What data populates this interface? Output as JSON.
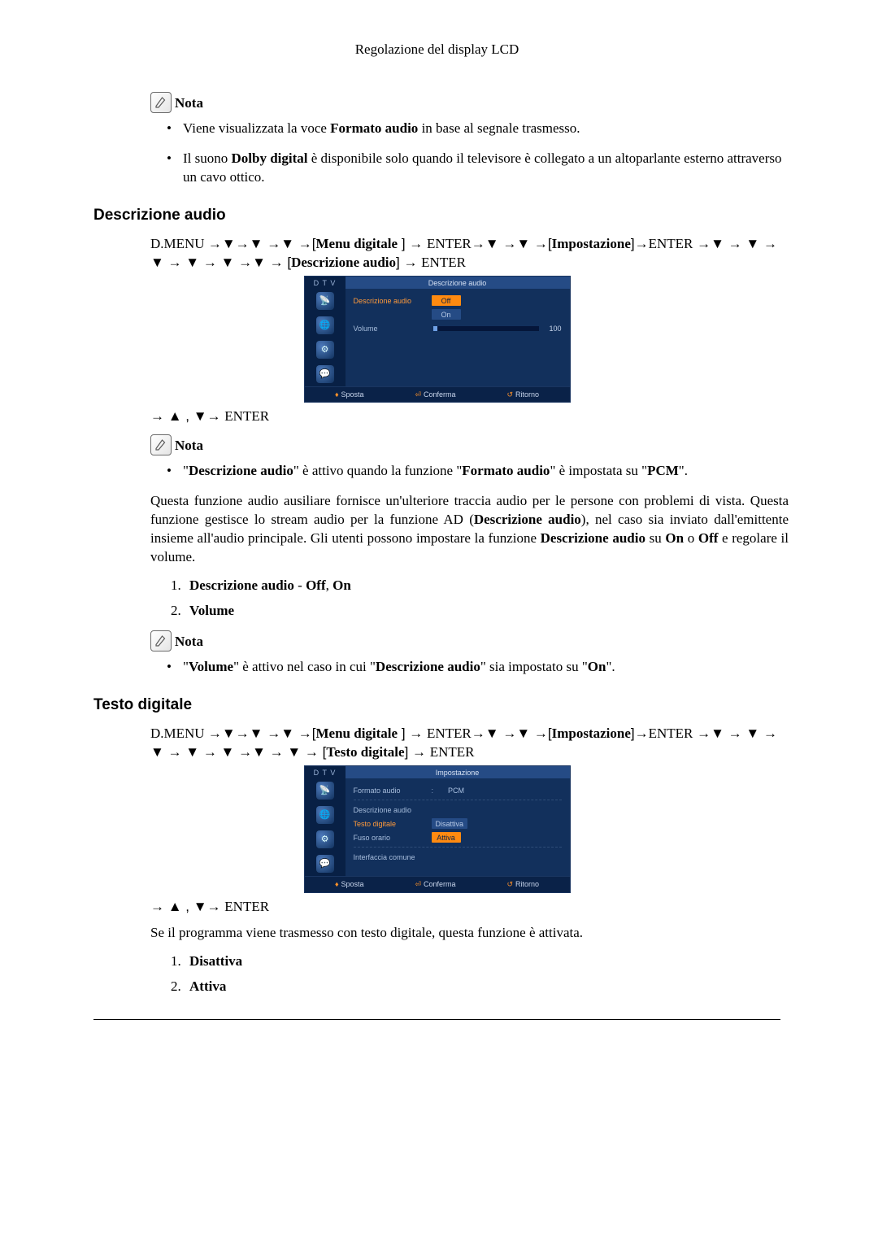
{
  "page": {
    "header": "Regolazione del display LCD"
  },
  "nota_label": "Nota",
  "enter": "ENTER",
  "dmenu": "D.MENU",
  "arrow_down": "▼",
  "arrow_up": "▲",
  "arrow_right": "→",
  "s1": {
    "bullets": {
      "b1_pre": "Viene visualizzata la voce ",
      "b1_bold": "Formato audio",
      "b1_post": " in base al segnale trasmesso.",
      "b2_pre": "Il suono ",
      "b2_bold": "Dolby digital",
      "b2_post": " è disponibile solo quando il televisore è collegato a un altoparlante esterno attraverso un cavo ottico."
    }
  },
  "s2": {
    "heading": "Descrizione audio",
    "path_menu": "Menu digitale",
    "path_imp": "Impostazione",
    "path_target": "Descrizione audio",
    "osd": {
      "tab_left": "D T V",
      "tab_right": "Descrizione audio",
      "row1_label": "Descrizione audio",
      "opt_off": "Off",
      "opt_on": "On",
      "row2_label": "Volume",
      "volume_value": "100",
      "footer_move": "Sposta",
      "footer_confirm": "Conferma",
      "footer_return": "Ritorno"
    },
    "nota1_bullet_pre": "\"",
    "nota1_b1": "Descrizione audio",
    "nota1_mid1": "\" è attivo quando la funzione \"",
    "nota1_b2": "Formato audio",
    "nota1_mid2": "\" è impostata su \"",
    "nota1_b3": "PCM",
    "nota1_post": "\".",
    "para_pre": "Questa funzione audio ausiliare fornisce un'ulteriore traccia audio per le persone con problemi di vista. Questa funzione gestisce lo stream audio per la funzione AD (",
    "para_b1": "Descrizione audio",
    "para_mid1": "), nel caso sia inviato dall'emittente insieme all'audio principale. Gli utenti possono impostare la funzione ",
    "para_b2": "Descrizione audio",
    "para_mid2": " su ",
    "para_b3": "On",
    "para_mid3": " o ",
    "para_b4": "Off",
    "para_post": " e regolare il volume.",
    "li1_b1": "Descrizione audio",
    "li1_mid": " - ",
    "li1_b2": "Off",
    "li1_sep": ", ",
    "li1_b3": "On",
    "li2_b1": "Volume",
    "nota2_pre": "\"",
    "nota2_b1": "Volume",
    "nota2_mid1": "\" è attivo nel caso in cui \"",
    "nota2_b2": "Descrizione audio",
    "nota2_mid2": "\" sia impostato su \"",
    "nota2_b3": "On",
    "nota2_post": "\"."
  },
  "s3": {
    "heading": "Testo digitale",
    "path_menu": "Menu digitale",
    "path_imp": "Impostazione",
    "path_target": "Testo digitale",
    "osd": {
      "tab_left": "D T V",
      "tab_right": "Impostazione",
      "row1_label": "Formato audio",
      "row1_val": "PCM",
      "row2_label": "Descrizione audio",
      "row3_label": "Testo digitale",
      "opt_dis": "Disattiva",
      "opt_att": "Attiva",
      "row4_label": "Fuso orario",
      "row5_label": "Interfaccia comune",
      "footer_move": "Sposta",
      "footer_confirm": "Conferma",
      "footer_return": "Ritorno"
    },
    "para": "Se il programma viene trasmesso con testo digitale, questa funzione è attivata.",
    "li1": "Disattiva",
    "li2": "Attiva"
  }
}
